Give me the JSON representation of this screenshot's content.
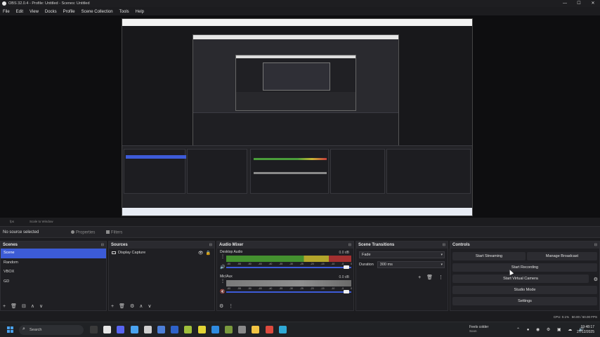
{
  "window": {
    "title": "OBS 32.0.4 - Profile: Untitled - Scenes: Untitled",
    "min": "—",
    "max": "☐",
    "close": "✕"
  },
  "menu": [
    "File",
    "Edit",
    "View",
    "Docks",
    "Profile",
    "Scene Collection",
    "Tools",
    "Help"
  ],
  "preview_toolbar": {
    "fit_label": "Scale to Window",
    "fps_label": "fps"
  },
  "context_bar": {
    "no_source": "No source selected",
    "properties": "Properties",
    "filters": "Filters"
  },
  "scenes": {
    "title": "Scenes",
    "menu_icon": "⊟",
    "items": [
      {
        "label": "Scene",
        "selected": true
      },
      {
        "label": "Random",
        "selected": false
      },
      {
        "label": "VBOX",
        "selected": false
      },
      {
        "label": "GD",
        "selected": false
      }
    ],
    "footer": [
      "+",
      "🗑",
      "⊟",
      "⧉",
      "∧",
      "∨"
    ]
  },
  "sources": {
    "title": "Sources",
    "menu_icon": "⊟",
    "items": [
      {
        "label": "Display Capture"
      }
    ],
    "footer": [
      "+",
      "🗑",
      "⚙",
      "∧",
      "∨"
    ]
  },
  "audio_mixer": {
    "title": "Audio Mixer",
    "menu_icon": "⊟",
    "channels": [
      {
        "name": "Desktop Audio",
        "db": "0.0 dB",
        "muted": false
      },
      {
        "name": "Mic/Aux",
        "db": "0.0 dB",
        "muted": true
      }
    ],
    "scale": [
      "-60",
      "-55",
      "-50",
      "-45",
      "-40",
      "-35",
      "-30",
      "-25",
      "-20",
      "-15",
      "-10",
      "-5",
      "0"
    ],
    "footer": [
      "⚙",
      "⋮"
    ]
  },
  "scene_transitions": {
    "title": "Scene Transitions",
    "menu_icon": "⊟",
    "transition": "Fade",
    "duration_label": "Duration",
    "duration_value": "300 ms",
    "buttons": [
      "+",
      "🗑",
      "⋮"
    ]
  },
  "controls": {
    "title": "Controls",
    "menu_icon": "⊟",
    "start_streaming": "Start Streaming",
    "manage_broadcast": "Manage Broadcast",
    "start_recording": "Start Recording",
    "start_virtual_camera": "Start Virtual Camera",
    "studio_mode": "Studio Mode",
    "settings": "Settings",
    "exit": "Exit"
  },
  "status_bar": {
    "cpu": "CPU: 0.1%",
    "fps": "50.00 / 50.00 FPS",
    "rec_time": "00:00:00",
    "stream_time": "00:00:00"
  },
  "taskbar": {
    "search_placeholder": "Search",
    "weather_title": "Feels colder",
    "weather_sub": "Soon",
    "time": "19:48:17",
    "date": "27/12/2025",
    "apps": [
      {
        "icon": "task-view-icon",
        "color": "#3a3a3a"
      },
      {
        "icon": "obs-icon",
        "color": "#e6e6e6"
      },
      {
        "icon": "discord-icon",
        "color": "#5865f2"
      },
      {
        "icon": "roblox-studio-icon",
        "color": "#4aa3f0"
      },
      {
        "icon": "unity-icon",
        "color": "#cfcfcf"
      },
      {
        "icon": "virtualbox-icon",
        "color": "#4d7fd8"
      },
      {
        "icon": "files-icon",
        "color": "#2e62c9"
      },
      {
        "icon": "android-icon",
        "color": "#9fbf3b"
      },
      {
        "icon": "geometry-dash-icon",
        "color": "#e3d435"
      },
      {
        "icon": "vscode-icon",
        "color": "#2f8be0"
      },
      {
        "icon": "minecraft-icon",
        "color": "#7a9a3d"
      },
      {
        "icon": "settings-icon",
        "color": "#8a8a8a"
      },
      {
        "icon": "file-explorer-icon",
        "color": "#f2c443"
      },
      {
        "icon": "chrome-icon",
        "color": "#dd4a3e"
      },
      {
        "icon": "edge-icon",
        "color": "#2fa9d6"
      }
    ]
  }
}
